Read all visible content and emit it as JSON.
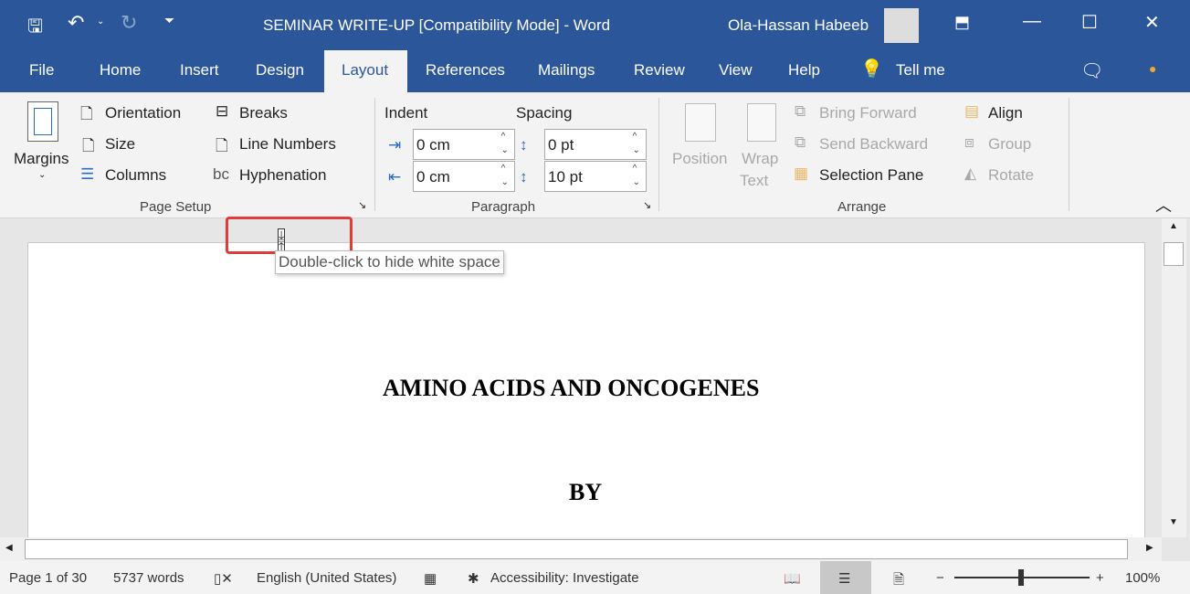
{
  "titlebar": {
    "title": "SEMINAR WRITE-UP [Compatibility Mode]  -  Word",
    "user": "Ola-Hassan Habeeb"
  },
  "tabs": [
    "File",
    "Home",
    "Insert",
    "Design",
    "Layout",
    "References",
    "Mailings",
    "Review",
    "View",
    "Help",
    "Tell me"
  ],
  "ribbon": {
    "page_setup": {
      "margins": "Margins",
      "orientation": "Orientation",
      "size": "Size",
      "columns": "Columns",
      "breaks": "Breaks",
      "line_numbers": "Line Numbers",
      "hyphenation": "Hyphenation",
      "label": "Page Setup"
    },
    "paragraph": {
      "indent": "Indent",
      "spacing": "Spacing",
      "indent_left": "0 cm",
      "indent_right": "0 cm",
      "spacing_before": "0 pt",
      "spacing_after": "10 pt",
      "label": "Paragraph"
    },
    "arrange": {
      "position": "Position",
      "wrap": "Wrap",
      "wrap2": "Text",
      "bring_forward": "Bring Forward",
      "send_backward": "Send Backward",
      "selection_pane": "Selection Pane",
      "align": "Align",
      "group": "Group",
      "rotate": "Rotate",
      "label": "Arrange"
    }
  },
  "tooltip": "Double-click to hide white space",
  "document": {
    "title": "AMINO ACIDS AND ONCOGENES",
    "by": "BY"
  },
  "status": {
    "page": "Page 1 of 30",
    "words": "5737 words",
    "language": "English (United States)",
    "accessibility": "Accessibility: Investigate",
    "zoom": "100%",
    "zoom_level_percent": 100
  },
  "colors": {
    "accent": "#2b579a",
    "highlight": "#e03c3c"
  }
}
